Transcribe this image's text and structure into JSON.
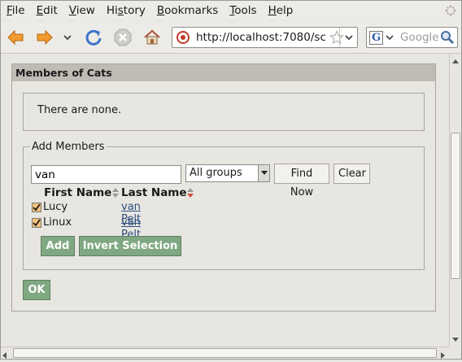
{
  "menu": {
    "items": [
      {
        "u": "F",
        "rest": "ile"
      },
      {
        "u": "E",
        "rest": "dit"
      },
      {
        "u": "V",
        "rest": "iew"
      },
      {
        "u": "",
        "pre": "Hi",
        "u2": "s",
        "rest": "tory"
      },
      {
        "u": "B",
        "rest": "ookmarks"
      },
      {
        "u": "T",
        "rest": "ools"
      },
      {
        "u": "H",
        "rest": "elp"
      }
    ]
  },
  "toolbar": {
    "icons": [
      "back-arrow-icon",
      "forward-arrow-icon",
      "history-dropdown-icon",
      "reload-icon",
      "stop-icon",
      "home-icon"
    ],
    "url": "http://localhost:7080/sc",
    "search_placeholder": "Google",
    "search_engine": "G"
  },
  "panel": {
    "title": "Members of Cats",
    "none_text": "There are none.",
    "add_members": {
      "legend": "Add Members",
      "search_value": "van",
      "group_selected": "All groups",
      "find_now_label": "Find Now",
      "clear_label": "Clear",
      "headers": {
        "first": "First Name",
        "last": "Last Name"
      },
      "rows": [
        {
          "first": "Lucy",
          "last": "van Pelt",
          "checked": true
        },
        {
          "first": "Linux",
          "last": "van Pelt",
          "checked": true
        }
      ],
      "add_label": "Add",
      "invert_label": "Invert Selection"
    },
    "ok_label": "OK"
  },
  "colors": {
    "chrome_bg": "#edebe7",
    "panel_title_bg": "#bfbcb5",
    "green_button": "#7fa882",
    "link": "#2b4d7e"
  }
}
